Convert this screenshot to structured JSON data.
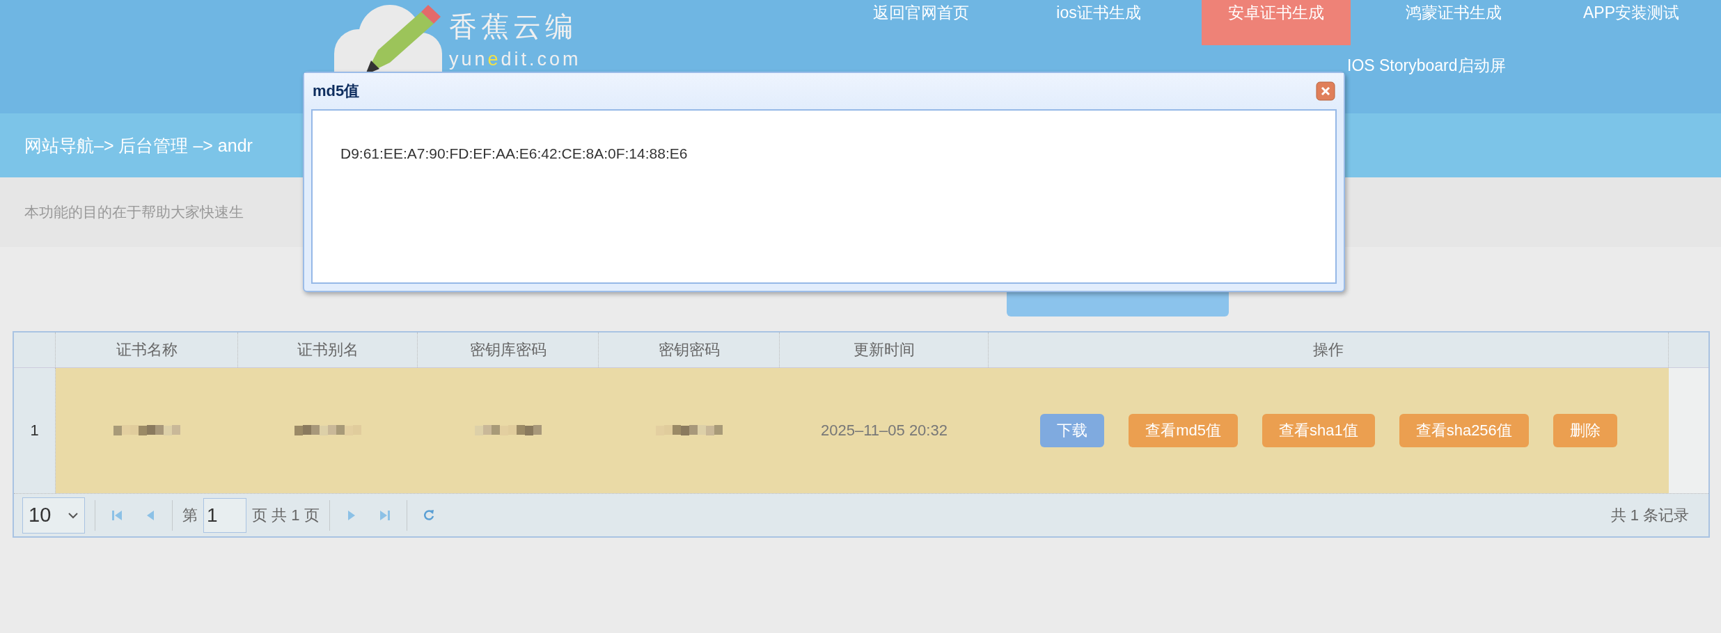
{
  "logo": {
    "name": "香蕉云编",
    "domain_parts": [
      {
        "text": "yun",
        "highlight": false
      },
      {
        "text": "e",
        "highlight": true
      },
      {
        "text": "dit.com",
        "highlight": false
      }
    ]
  },
  "nav": {
    "row_1": [
      {
        "label": "返回官网首页",
        "selected": false
      },
      {
        "label": "ios证书生成",
        "selected": false
      },
      {
        "label": "安卓证书生成",
        "selected": true
      },
      {
        "label": "鸿蒙证书生成",
        "selected": false
      },
      {
        "label": "APP安装测试",
        "selected": false
      }
    ],
    "row_2": [
      {
        "label": "IOS Storyboard启动屏",
        "selected": false
      }
    ]
  },
  "breadcrumb": "网站导航–> 后台管理 –> andr",
  "description": "本功能的目的在于帮助大家快速生",
  "table": {
    "columns": [
      "证书名称",
      "证书别名",
      "密钥库密码",
      "密钥密码",
      "更新时间",
      "操作"
    ],
    "rows": [
      {
        "number": "1",
        "selected": true,
        "cells": [
          {
            "kind": "blurred"
          },
          {
            "kind": "blurred"
          },
          {
            "kind": "blurred"
          },
          {
            "kind": "blurred"
          },
          {
            "kind": "text",
            "text": "2025–11–05 20:32"
          }
        ],
        "actions": [
          {
            "label": "下载",
            "kind": "primary"
          },
          {
            "label": "查看md5值",
            "kind": "warning"
          },
          {
            "label": "查看sha1值",
            "kind": "warning"
          },
          {
            "label": "查看sha256值",
            "kind": "warning"
          },
          {
            "label": "删除",
            "kind": "warning"
          }
        ]
      }
    ]
  },
  "pager": {
    "page_size": "10",
    "before_page": "第",
    "page": "1",
    "after_page": "页 共 1 页",
    "summary": "共 1 条记录"
  },
  "dialog": {
    "title": "md5值",
    "value": "D9:61:EE:A7:90:FD:EF:AA:E6:42:CE:8A:0F:14:88:E6"
  }
}
